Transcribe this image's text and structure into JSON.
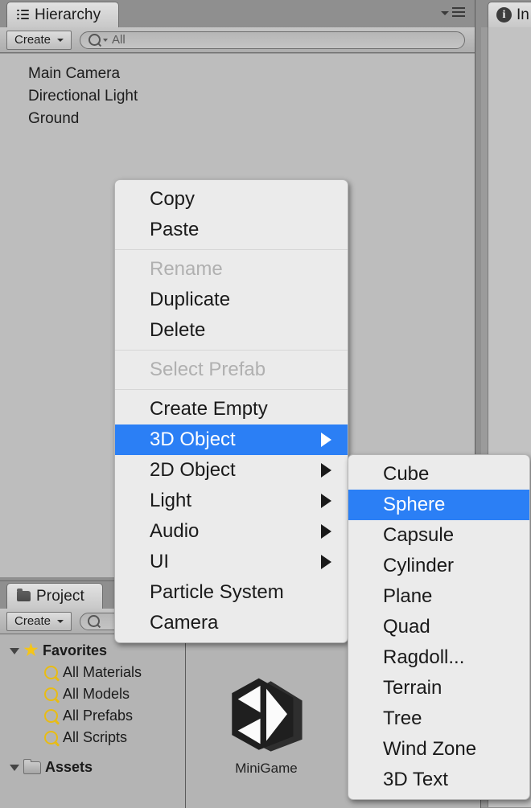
{
  "hierarchy_panel": {
    "tab_label": "Hierarchy",
    "tab_icon": "hierarchy-list-icon",
    "panel_menu_icon": "panel-options-icon",
    "toolbar": {
      "create_label": "Create",
      "create_dropdown_icon": "chevron-down-icon",
      "search_icon": "search-icon",
      "search_placeholder": "All",
      "search_value": ""
    },
    "objects": [
      {
        "name": "Main Camera"
      },
      {
        "name": "Directional Light"
      },
      {
        "name": "Ground"
      }
    ]
  },
  "project_panel": {
    "tab_label": "Project",
    "tab_icon": "folder-icon",
    "toolbar": {
      "create_label": "Create",
      "create_dropdown_icon": "chevron-down-icon",
      "search_icon": "search-icon"
    },
    "tree": [
      {
        "label": "Favorites",
        "icon": "star-icon",
        "depth": 0,
        "expanded": true,
        "bold": true
      },
      {
        "label": "All Materials",
        "icon": "search-saved-icon",
        "depth": 1,
        "expanded": null,
        "bold": false
      },
      {
        "label": "All Models",
        "icon": "search-saved-icon",
        "depth": 1,
        "expanded": null,
        "bold": false
      },
      {
        "label": "All Prefabs",
        "icon": "search-saved-icon",
        "depth": 1,
        "expanded": null,
        "bold": false
      },
      {
        "label": "All Scripts",
        "icon": "search-saved-icon",
        "depth": 1,
        "expanded": null,
        "bold": false
      },
      {
        "label": "Assets",
        "icon": "folder-open-icon",
        "depth": 0,
        "expanded": true,
        "bold": true
      }
    ],
    "assets": [
      {
        "label": "MiniGame",
        "icon": "unity-scene-icon"
      }
    ]
  },
  "inspector_panel": {
    "tab_label": "In",
    "tab_icon": "info-icon"
  },
  "context_menu": {
    "name": "hierarchy-context-menu",
    "items": [
      {
        "label": "Copy",
        "type": "item",
        "state": "normal",
        "submenu": false
      },
      {
        "label": "Paste",
        "type": "item",
        "state": "normal",
        "submenu": false
      },
      {
        "label": "",
        "type": "separator",
        "state": "normal",
        "submenu": false
      },
      {
        "label": "Rename",
        "type": "item",
        "state": "disabled",
        "submenu": false
      },
      {
        "label": "Duplicate",
        "type": "item",
        "state": "normal",
        "submenu": false
      },
      {
        "label": "Delete",
        "type": "item",
        "state": "normal",
        "submenu": false
      },
      {
        "label": "",
        "type": "separator",
        "state": "normal",
        "submenu": false
      },
      {
        "label": "Select Prefab",
        "type": "item",
        "state": "disabled",
        "submenu": false
      },
      {
        "label": "",
        "type": "separator",
        "state": "normal",
        "submenu": false
      },
      {
        "label": "Create Empty",
        "type": "item",
        "state": "normal",
        "submenu": false
      },
      {
        "label": "3D Object",
        "type": "item",
        "state": "selected",
        "submenu": true
      },
      {
        "label": "2D Object",
        "type": "item",
        "state": "normal",
        "submenu": true
      },
      {
        "label": "Light",
        "type": "item",
        "state": "normal",
        "submenu": true
      },
      {
        "label": "Audio",
        "type": "item",
        "state": "normal",
        "submenu": true
      },
      {
        "label": "UI",
        "type": "item",
        "state": "normal",
        "submenu": true
      },
      {
        "label": "Particle System",
        "type": "item",
        "state": "normal",
        "submenu": false
      },
      {
        "label": "Camera",
        "type": "item",
        "state": "normal",
        "submenu": false
      }
    ]
  },
  "submenu": {
    "name": "3d-object-submenu",
    "parent": "3D Object",
    "items": [
      {
        "label": "Cube",
        "state": "normal"
      },
      {
        "label": "Sphere",
        "state": "selected"
      },
      {
        "label": "Capsule",
        "state": "normal"
      },
      {
        "label": "Cylinder",
        "state": "normal"
      },
      {
        "label": "Plane",
        "state": "normal"
      },
      {
        "label": "Quad",
        "state": "normal"
      },
      {
        "label": "Ragdoll...",
        "state": "normal"
      },
      {
        "label": "Terrain",
        "state": "normal"
      },
      {
        "label": "Tree",
        "state": "normal"
      },
      {
        "label": "Wind Zone",
        "state": "normal"
      },
      {
        "label": "3D Text",
        "state": "normal"
      }
    ]
  },
  "colors": {
    "menu_background": "#ebebeb",
    "menu_highlight": "#2b7ff5",
    "menu_text": "#1a1a1a",
    "menu_text_disabled": "#b0b0b0",
    "panel_background": "#bdbdbd",
    "chrome_background": "#8f8f8f",
    "favorite_star": "#f5c518"
  }
}
